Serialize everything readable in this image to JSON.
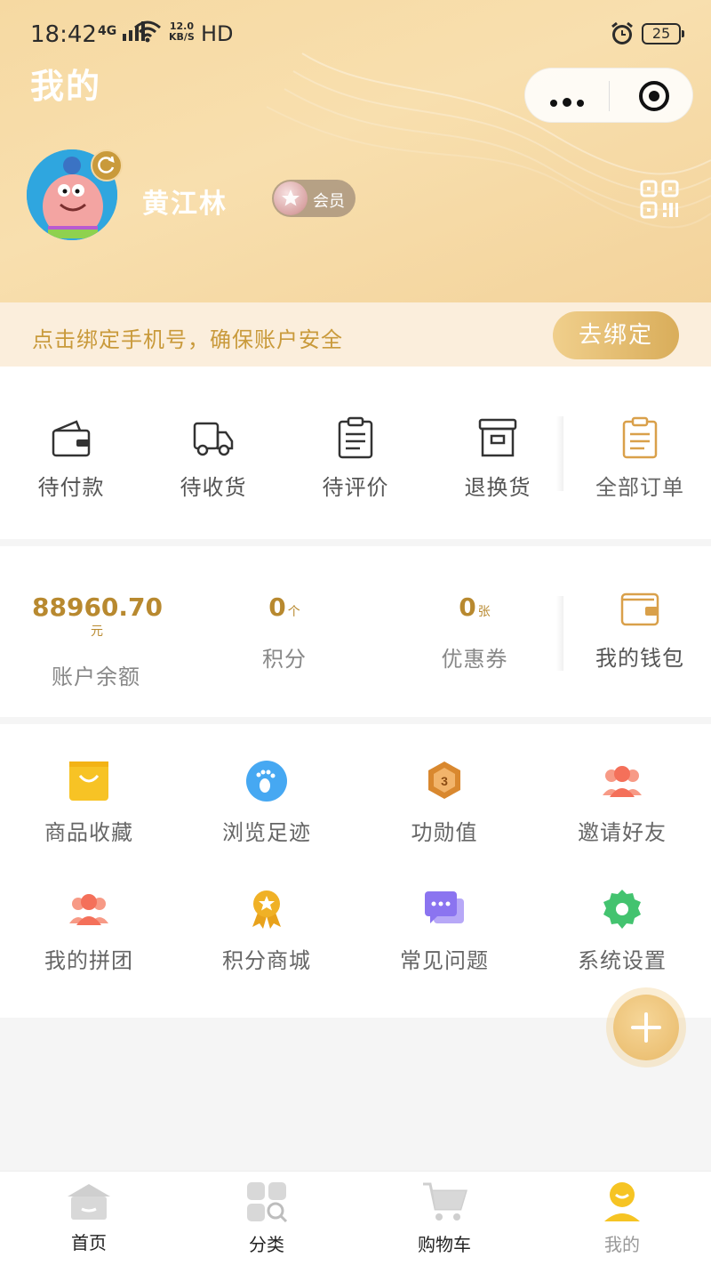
{
  "status_bar": {
    "time": "18:42",
    "network": "4G",
    "speed_value": "12.0",
    "speed_unit": "KB/S",
    "hd": "HD",
    "battery": "25"
  },
  "header": {
    "title": "我的",
    "username": "黄江林",
    "member_label": "会员"
  },
  "bind_bar": {
    "text": "点击绑定手机号，确保账户安全",
    "button": "去绑定"
  },
  "orders": [
    {
      "label": "待付款",
      "icon": "wallet-icon"
    },
    {
      "label": "待收货",
      "icon": "truck-icon"
    },
    {
      "label": "待评价",
      "icon": "clipboard-icon"
    },
    {
      "label": "退换货",
      "icon": "box-icon"
    },
    {
      "label": "全部订单",
      "icon": "all-orders-icon"
    }
  ],
  "assets": {
    "balance": {
      "value": "88960.70",
      "unit": "元",
      "label": "账户余额"
    },
    "points": {
      "value": "0",
      "unit": "个",
      "label": "积分"
    },
    "coupons": {
      "value": "0",
      "unit": "张",
      "label": "优惠券"
    },
    "wallet": {
      "label": "我的钱包",
      "icon": "wallet-icon"
    }
  },
  "services": [
    {
      "label": "商品收藏",
      "icon": "shopping-bag-icon",
      "color": "#f7c325"
    },
    {
      "label": "浏览足迹",
      "icon": "footprint-icon",
      "color": "#46a8f2"
    },
    {
      "label": "功勋值",
      "icon": "medal-icon",
      "color": "#d9882f"
    },
    {
      "label": "邀请好友",
      "icon": "invite-friends-icon",
      "color": "#f4705a"
    },
    {
      "label": "我的拼团",
      "icon": "group-buy-icon",
      "color": "#f4705a"
    },
    {
      "label": "积分商城",
      "icon": "award-icon",
      "color": "#f0b126"
    },
    {
      "label": "常见问题",
      "icon": "chat-icon",
      "color": "#8b74f0"
    },
    {
      "label": "系统设置",
      "icon": "settings-icon",
      "color": "#43c36f"
    }
  ],
  "tabbar": [
    {
      "label": "首页",
      "icon": "home-icon"
    },
    {
      "label": "分类",
      "icon": "category-icon"
    },
    {
      "label": "购物车",
      "icon": "cart-icon"
    },
    {
      "label": "我的",
      "icon": "profile-icon"
    }
  ],
  "theme": {
    "gold": "#c99a3b",
    "header_bg": "#f6d9a2",
    "bind_bar_bg": "#fbeedc"
  }
}
